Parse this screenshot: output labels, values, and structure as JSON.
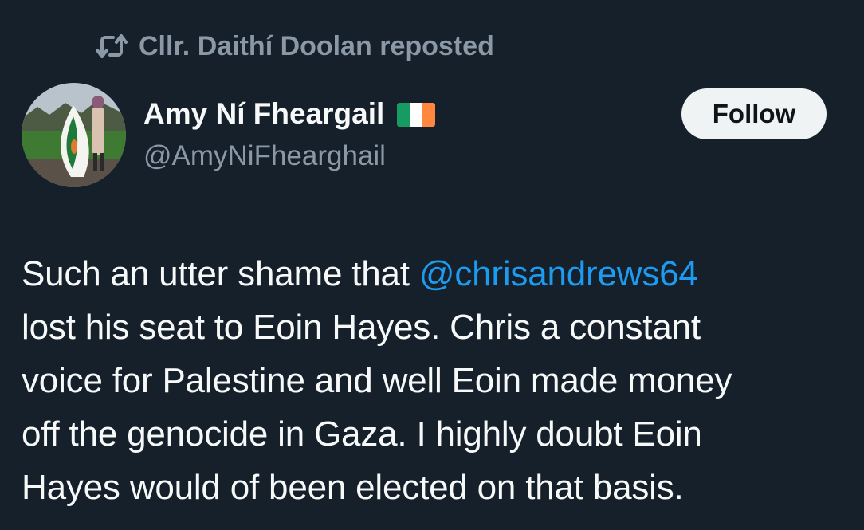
{
  "repost": {
    "icon": "repost-icon",
    "text": "Cllr. Daithí Doolan reposted"
  },
  "author": {
    "display_name": "Amy Ní Fheargail",
    "flag_icon": "ireland-flag-icon",
    "flag_colors": [
      "#169b62",
      "#ffffff",
      "#ff883e"
    ],
    "handle": "@AmyNiFhearghail",
    "avatar_icon": "avatar"
  },
  "follow_button": {
    "label": "Follow"
  },
  "tweet": {
    "line1_before": "Such an utter shame that ",
    "mention": "@chrisandrews64",
    "line2": "lost his seat to Eoin Hayes. Chris a constant",
    "line3": "voice for Palestine and well Eoin made money",
    "line4": "off the genocide in Gaza. I highly doubt Eoin",
    "line5": "Hayes would of been elected on that basis."
  },
  "colors": {
    "background": "#15202b",
    "text_primary": "#f7f9f9",
    "text_secondary": "#8b98a5",
    "link": "#1d9bf0",
    "button_bg": "#eff3f4"
  }
}
